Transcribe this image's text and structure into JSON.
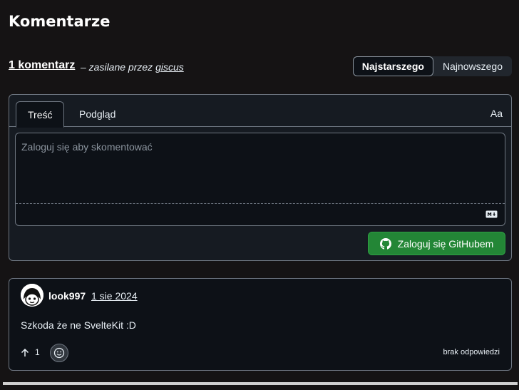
{
  "page": {
    "title": "Komentarze"
  },
  "meta": {
    "count_label": "1 komentarz",
    "powered_prefix": "– zasilane przez",
    "powered_link": "giscus"
  },
  "sort": {
    "oldest": "Najstarszego",
    "newest": "Najnowszego",
    "active": "oldest"
  },
  "editor": {
    "tab_write": "Treść",
    "tab_preview": "Podgląd",
    "font_toggle": "Aa",
    "placeholder": "Zaloguj się aby skomentować",
    "markdown_icon": "markdown-icon",
    "login_button": "Zaloguj się GitHubem",
    "login_icon": "github-icon"
  },
  "comments": [
    {
      "author": "look997",
      "date": "1 sie 2024",
      "text": "Szkoda że ne SvelteKit :D",
      "upvotes": "1",
      "replies": "brak odpowiedzi"
    }
  ],
  "colors": {
    "background": "#151314",
    "accent_green": "#238636",
    "border": "#6e7681"
  }
}
